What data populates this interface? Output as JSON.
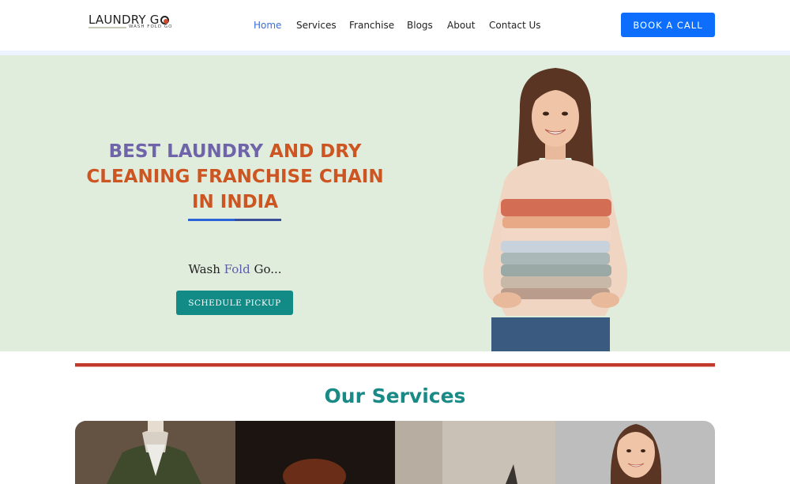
{
  "header": {
    "logo_text": "LAUNDRY G",
    "logo_tagline": "WASH  FOLD  GO",
    "nav": [
      {
        "label": "Home",
        "active": true
      },
      {
        "label": "Services",
        "active": false
      },
      {
        "label": "Franchise",
        "active": false
      },
      {
        "label": "Blogs",
        "active": false
      },
      {
        "label": "About",
        "active": false
      },
      {
        "label": "Contact Us",
        "active": false
      }
    ],
    "cta_label": "BOOK A CALL"
  },
  "hero": {
    "title_purple": "BEST LAUNDRY",
    "title_orange_1": "AND DRY",
    "title_orange_2": "CLEANING FRANCHISE CHAIN",
    "title_orange_3": "IN INDIA",
    "tagline_1": "Wash",
    "tagline_2": "Fold",
    "tagline_3": "Go...",
    "button_label": "SCHEDULE PICKUP"
  },
  "services": {
    "title": "Our Services",
    "cards": [
      {
        "name": "suit-dry-cleaning"
      },
      {
        "name": "shoe-cleaning"
      },
      {
        "name": "home-cleaning"
      },
      {
        "name": "laundry-service"
      }
    ]
  },
  "colors": {
    "primary_blue": "#0d6efd",
    "teal": "#128a86",
    "orange": "#cc5522",
    "purple": "#6f64a9",
    "hero_bg": "#e0eddd",
    "divider_red": "#c0392b"
  }
}
